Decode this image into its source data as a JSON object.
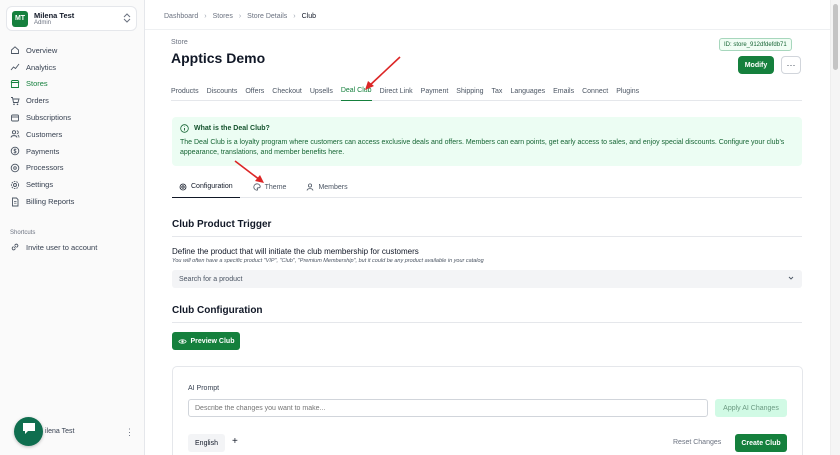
{
  "user": {
    "initials": "MT",
    "name": "Milena Test",
    "role": "Admin"
  },
  "sidebar": {
    "items": [
      {
        "label": "Overview",
        "icon": "home-icon"
      },
      {
        "label": "Analytics",
        "icon": "chart-icon"
      },
      {
        "label": "Stores",
        "icon": "store-icon",
        "active": true
      },
      {
        "label": "Orders",
        "icon": "cart-icon"
      },
      {
        "label": "Subscriptions",
        "icon": "refresh-icon"
      },
      {
        "label": "Customers",
        "icon": "users-icon"
      },
      {
        "label": "Payments",
        "icon": "dollar-icon"
      },
      {
        "label": "Processors",
        "icon": "card-icon"
      },
      {
        "label": "Settings",
        "icon": "gear-icon"
      },
      {
        "label": "Billing Reports",
        "icon": "file-icon"
      }
    ],
    "shortcuts_title": "Shortcuts",
    "shortcut_label": "Invite user to account",
    "bottom_user_name": "ilena Test"
  },
  "breadcrumb": {
    "items": [
      "Dashboard",
      "Stores",
      "Store Details"
    ],
    "current": "Club",
    "sep": "›"
  },
  "store": {
    "label": "Store",
    "title": "Apptics Demo",
    "id": "ID: store_912dfdefdb71"
  },
  "header": {
    "modify_label": "Modify",
    "more_label": "···"
  },
  "tabs": [
    "Products",
    "Discounts",
    "Offers",
    "Checkout",
    "Upsells",
    "Deal Club",
    "Direct Link",
    "Payment",
    "Shipping",
    "Tax",
    "Languages",
    "Emails",
    "Connect",
    "Plugins"
  ],
  "active_tab": "Deal Club",
  "info": {
    "title": "What is the Deal Club?",
    "text": "The Deal Club is a loyalty program where customers can access exclusive deals and offers. Members can earn points, get early access to sales, and enjoy special discounts. Configure your club's appearance, translations, and member benefits here."
  },
  "sub_tabs": {
    "configuration": "Configuration",
    "theme": "Theme",
    "members": "Members"
  },
  "trigger": {
    "title": "Club Product Trigger",
    "label": "Define the product that will initiate the club membership for customers",
    "hint": "You will often have a specific product \"VIP\", \"Club\", \"Premium Membership\", but it could be any product available in your catalog",
    "placeholder": "Search for a product"
  },
  "club_config": {
    "title": "Club Configuration",
    "preview_label": "Preview Club",
    "ai_label": "AI Prompt",
    "ai_placeholder": "Describe the changes you want to make...",
    "ai_apply": "Apply AI Changes",
    "language": "English",
    "add_language": "+",
    "reset": "Reset Changes",
    "create": "Create Club"
  },
  "colors": {
    "accent": "#15803d",
    "info_bg": "#ecfdf3",
    "annotation": "#dc2626"
  }
}
